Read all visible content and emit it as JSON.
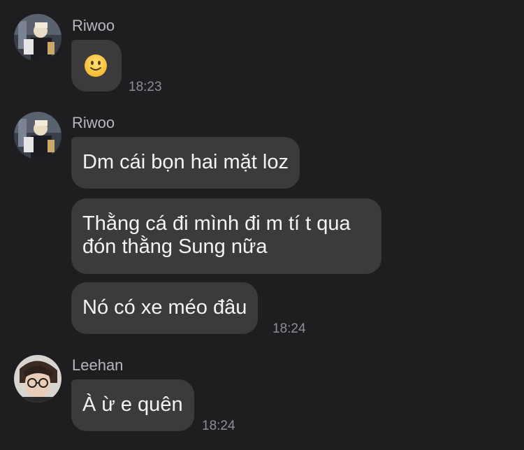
{
  "messages": [
    {
      "sender": "Riwoo",
      "bubbles": [
        {
          "text": "",
          "emoji": "slightly-smiling-face"
        }
      ],
      "time": "18:23"
    },
    {
      "sender": "Riwoo",
      "bubbles": [
        {
          "text": "Dm cái bọn hai mặt loz"
        },
        {
          "text": "Thằng cá đi mình đi m tí t qua đón thằng Sung nữa"
        },
        {
          "text": "Nó có xe méo đâu"
        }
      ],
      "time": "18:24"
    },
    {
      "sender": "Leehan",
      "bubbles": [
        {
          "text": "À ừ e quên"
        }
      ],
      "time": "18:24"
    }
  ],
  "colors": {
    "background": "#1e1e20",
    "bubble": "#3b3b3e",
    "text": "#f4f4f4",
    "sender": "#b8b8bc",
    "time": "#8e8e93"
  }
}
